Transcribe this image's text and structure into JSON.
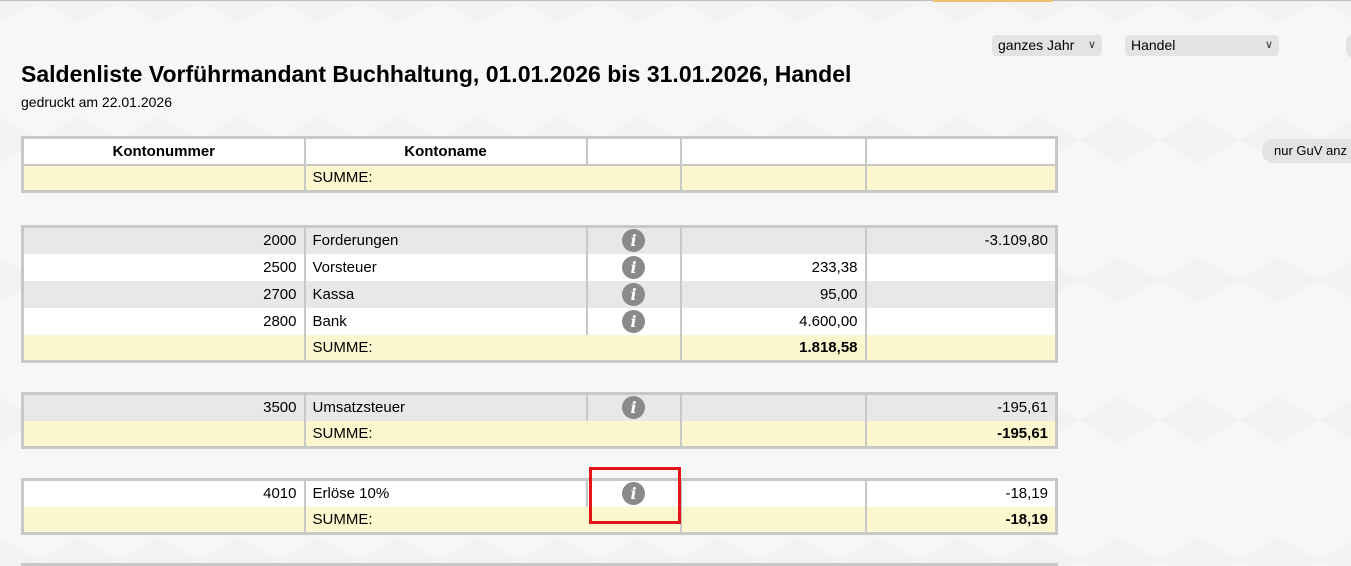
{
  "filters": {
    "period": "ganzes Jahr",
    "branch": "Handel",
    "guv_button": "nur GuV anz"
  },
  "report": {
    "title": "Saldenliste Vorführmandant Buchhaltung, 01.01.2026 bis 31.01.2026, Handel",
    "printed": "gedruckt am 22.01.2026"
  },
  "header": {
    "account_number": "Kontonummer",
    "account_name": "Kontoname",
    "sum_label": "SUMME:"
  },
  "groups": [
    {
      "rows": [
        {
          "number": "2000",
          "name": "Forderungen",
          "debit": "",
          "credit": "-3.109,80"
        },
        {
          "number": "2500",
          "name": "Vorsteuer",
          "debit": "233,38",
          "credit": ""
        },
        {
          "number": "2700",
          "name": "Kassa",
          "debit": "95,00",
          "credit": ""
        },
        {
          "number": "2800",
          "name": "Bank",
          "debit": "4.600,00",
          "credit": ""
        }
      ],
      "sum_label": "SUMME:",
      "sum_debit": "1.818,58",
      "sum_credit": ""
    },
    {
      "rows": [
        {
          "number": "3500",
          "name": "Umsatzsteuer",
          "debit": "",
          "credit": "-195,61"
        }
      ],
      "sum_label": "SUMME:",
      "sum_debit": "",
      "sum_credit": "-195,61"
    },
    {
      "rows": [
        {
          "number": "4010",
          "name": "Erlöse 10%",
          "debit": "",
          "credit": "-18,19"
        }
      ],
      "sum_label": "SUMME:",
      "sum_debit": "",
      "sum_credit": "-18,19"
    }
  ],
  "icons": {
    "info": "info-icon",
    "chevron": "chevron-down-icon"
  },
  "colors": {
    "gray_row": "#e8e8e8",
    "sum_row": "#fdf7cf",
    "highlight": "#e3151a",
    "info_icon": "#8a8a8a"
  }
}
